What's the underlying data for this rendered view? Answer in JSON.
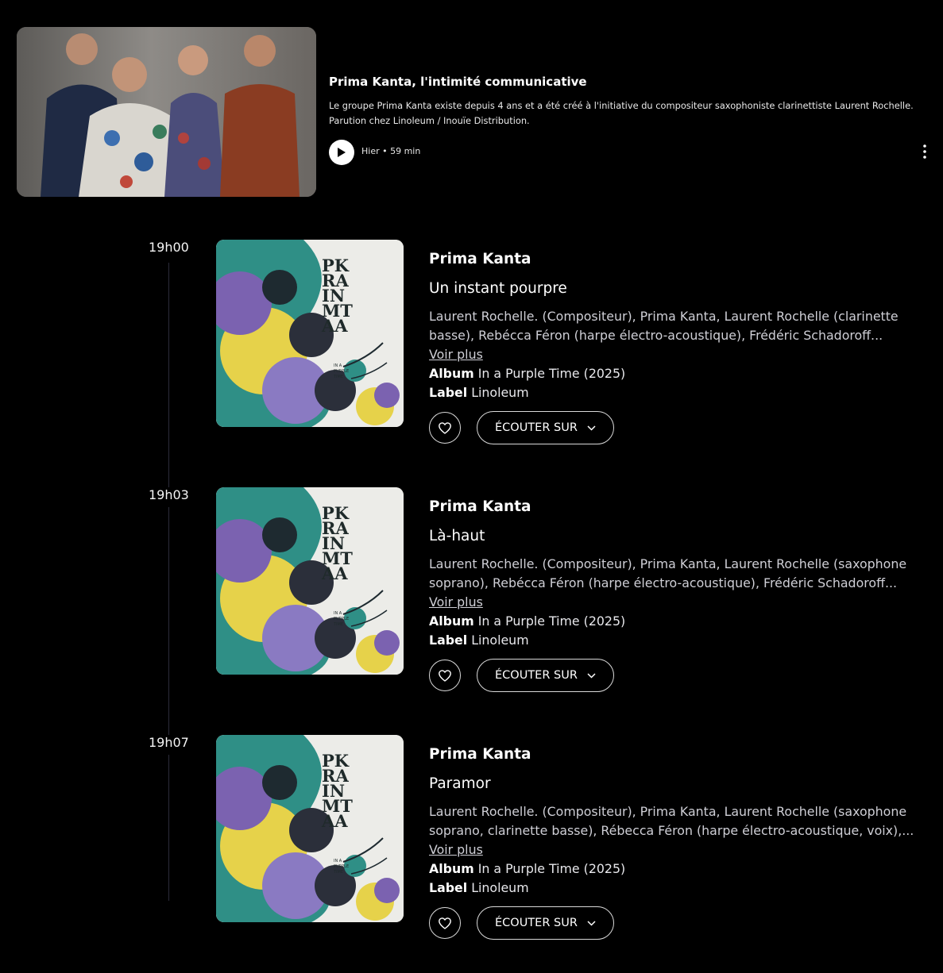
{
  "episode": {
    "title": "Prima Kanta, l'intimité communicative",
    "description": "Le groupe Prima Kanta existe depuis 4 ans et a été créé à l'initiative du compositeur saxophoniste clarinettiste Laurent Rochelle. Parution chez Linoleum / Inouïe Distribution.",
    "meta": "Hier • 59 min",
    "icons": {
      "play": "play-icon",
      "more": "more-vertical-icon"
    }
  },
  "cover": {
    "logo_lines": [
      "PK",
      "RA",
      "IN",
      "MT",
      "AA"
    ],
    "subtitle_lines": [
      "IN A",
      "PURPLE",
      "TIME"
    ]
  },
  "ui": {
    "more_label": "Voir plus",
    "album_label": "Album",
    "label_label": "Label",
    "listen_label": "ÉCOUTER SUR"
  },
  "tracks": [
    {
      "time": "19h00",
      "artist": "Prima Kanta",
      "title": "Un instant pourpre",
      "credits": "Laurent Rochelle. (Compositeur), Prima Kanta, Laurent Rochelle (clarinette basse), Rebécca Féron (harpe électro-acoustique), Frédéric Schadoroff...",
      "album": "In a Purple Time (2025)",
      "label": "Linoleum"
    },
    {
      "time": "19h03",
      "artist": "Prima Kanta",
      "title": "Là-haut",
      "credits": "Laurent Rochelle. (Compositeur), Prima Kanta, Laurent Rochelle (saxophone soprano), Rebécca Féron (harpe électro-acoustique), Frédéric Schadoroff...",
      "album": "In a Purple Time (2025)",
      "label": "Linoleum"
    },
    {
      "time": "19h07",
      "artist": "Prima Kanta",
      "title": "Paramor",
      "credits": "Laurent Rochelle. (Compositeur), Prima Kanta, Laurent Rochelle (saxophone soprano, clarinette basse), Rébecca Féron (harpe électro-acoustique, voix),...",
      "album": "In a Purple Time (2025)",
      "label": "Linoleum"
    }
  ],
  "colors": {
    "background": "#000000",
    "text": "#ffffff",
    "muted_text": "#cfcfd6",
    "timeline": "#2b2b3a",
    "cover_purple": "#7b62b0",
    "cover_yellow": "#e6d24a",
    "cover_teal": "#2f8f86"
  }
}
